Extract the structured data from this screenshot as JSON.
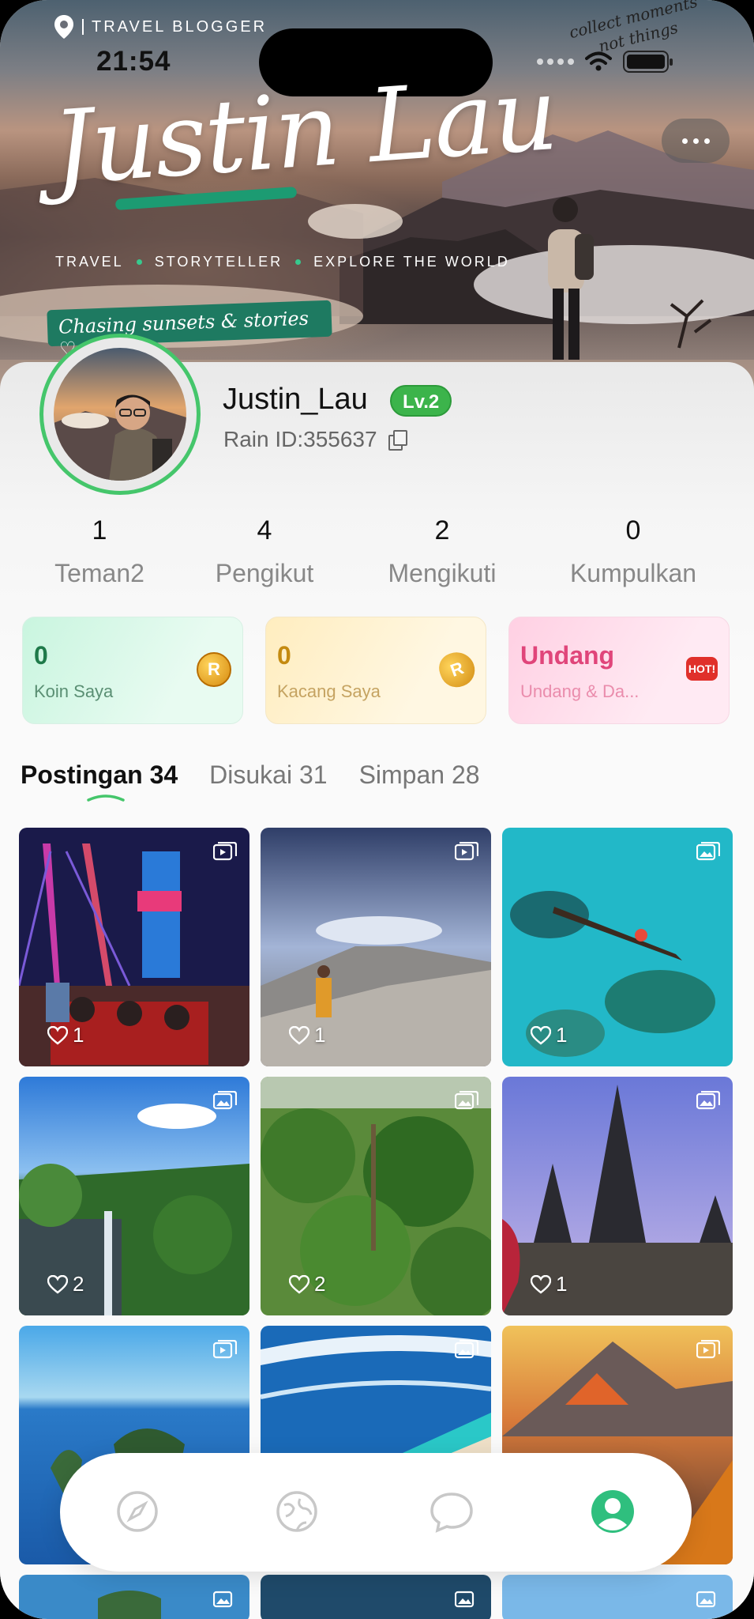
{
  "status_bar": {
    "time": "21:54"
  },
  "hero": {
    "location_label": "TRAVEL BLOGGER",
    "title": "Justin Lau",
    "tagline": [
      "TRAVEL",
      "STORYTELLER",
      "EXPLORE THE WORLD"
    ],
    "ribbon": "Chasing sunsets & stories ♡",
    "corner_note": "collect moments\nnot things"
  },
  "profile": {
    "username": "Justin_Lau",
    "level": "Lv.2",
    "rain_id": "Rain ID:355637"
  },
  "stats": [
    {
      "value": "1",
      "label": "Teman2"
    },
    {
      "value": "4",
      "label": "Pengikut"
    },
    {
      "value": "2",
      "label": "Mengikuti"
    },
    {
      "value": "0",
      "label": "Kumpulkan"
    }
  ],
  "wallet": [
    {
      "value": "0",
      "label": "Koin Saya",
      "badge": "R"
    },
    {
      "value": "0",
      "label": "Kacang Saya",
      "badge": "R"
    },
    {
      "value": "Undang",
      "label": "Undang & Da...",
      "badge": "HOT!"
    }
  ],
  "tabs": [
    {
      "label": "Postingan 34",
      "active": true
    },
    {
      "label": "Disukai 31",
      "active": false
    },
    {
      "label": "Simpan 28",
      "active": false
    }
  ],
  "posts": [
    {
      "likes": "1",
      "media": "video-icon",
      "scene": "city-bridge-night"
    },
    {
      "likes": "1",
      "media": "video-icon",
      "scene": "volcano-crater"
    },
    {
      "likes": "1",
      "media": "image-icon",
      "scene": "turquoise-sea-kayak"
    },
    {
      "likes": "2",
      "media": "image-icon",
      "scene": "waterfall-jungle"
    },
    {
      "likes": "2",
      "media": "image-icon",
      "scene": "palm-jungle"
    },
    {
      "likes": "1",
      "media": "image-icon",
      "scene": "temple-pagoda"
    },
    {
      "likes": "",
      "media": "video-icon",
      "scene": "island-coast"
    },
    {
      "likes": "",
      "media": "image-icon",
      "scene": "ocean-waves"
    },
    {
      "likes": "",
      "media": "video-icon",
      "scene": "bromo-sunrise"
    }
  ],
  "nav": [
    "compass-icon",
    "globe-icon",
    "chat-icon",
    "profile-icon"
  ],
  "colors": {
    "accent_green": "#45c66b",
    "level_green": "#3cb44b"
  }
}
